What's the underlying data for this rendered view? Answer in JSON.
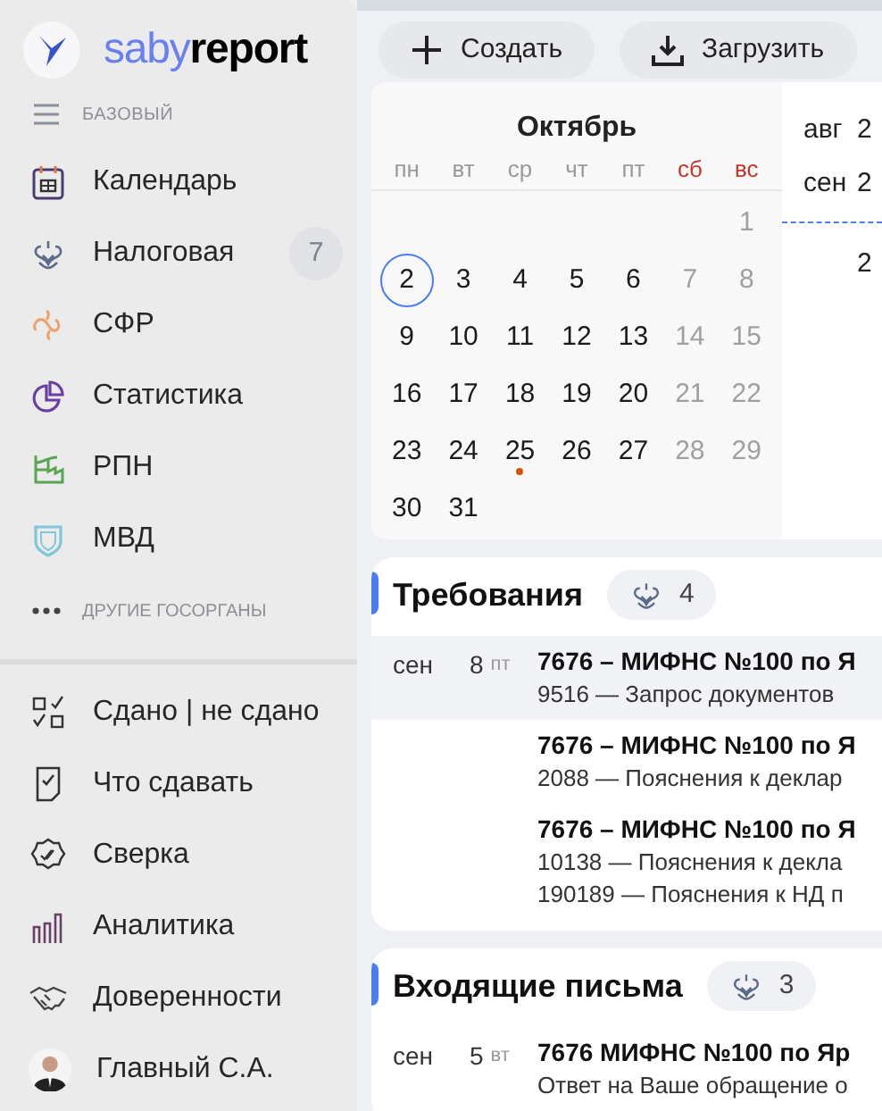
{
  "logo": {
    "part1": "saby",
    "part2": "report"
  },
  "sidebar": {
    "section": "БАЗОВЫЙ",
    "items": [
      {
        "label": "Календарь",
        "kind": "calendar"
      },
      {
        "label": "Налоговая",
        "kind": "eagle",
        "badge": "7"
      },
      {
        "label": "СФР",
        "kind": "loop"
      },
      {
        "label": "Статистика",
        "kind": "pie"
      },
      {
        "label": "РПН",
        "kind": "factory"
      },
      {
        "label": "МВД",
        "kind": "shield"
      }
    ],
    "more": "ДРУГИЕ ГОСОРГАНЫ",
    "tools": [
      {
        "label": "Сдано | не сдано",
        "kind": "checklist"
      },
      {
        "label": "Что сдавать",
        "kind": "document"
      },
      {
        "label": "Сверка",
        "kind": "seal"
      },
      {
        "label": "Аналитика",
        "kind": "bars"
      },
      {
        "label": "Доверенности",
        "kind": "handshake"
      },
      {
        "label": "Главный С.А.",
        "kind": "avatar"
      }
    ]
  },
  "toolbar": [
    {
      "label": "Создать",
      "kind": "plus"
    },
    {
      "label": "Загрузить",
      "kind": "download"
    }
  ],
  "calendar": {
    "month": "Октябрь",
    "weekdays": [
      {
        "label": "пн",
        "weekend": false
      },
      {
        "label": "вт",
        "weekend": false
      },
      {
        "label": "ср",
        "weekend": false
      },
      {
        "label": "чт",
        "weekend": false
      },
      {
        "label": "пт",
        "weekend": false
      },
      {
        "label": "сб",
        "weekend": true
      },
      {
        "label": "вс",
        "weekend": true
      }
    ],
    "weeks": [
      [
        {
          "day": "1",
          "weekend": true,
          "today": false,
          "event": false
        }
      ],
      [
        {
          "day": "2",
          "weekend": false,
          "today": true,
          "event": false
        },
        {
          "day": "3",
          "weekend": false,
          "today": false,
          "event": false
        },
        {
          "day": "4",
          "weekend": false,
          "today": false,
          "event": false
        },
        {
          "day": "5",
          "weekend": false,
          "today": false,
          "event": false
        },
        {
          "day": "6",
          "weekend": false,
          "today": false,
          "event": false
        },
        {
          "day": "7",
          "weekend": true,
          "today": false,
          "event": false
        },
        {
          "day": "8",
          "weekend": true,
          "today": false,
          "event": false
        }
      ],
      [
        {
          "day": "9",
          "weekend": false,
          "today": false,
          "event": false
        },
        {
          "day": "10",
          "weekend": false,
          "today": false,
          "event": false
        },
        {
          "day": "11",
          "weekend": false,
          "today": false,
          "event": false
        },
        {
          "day": "12",
          "weekend": false,
          "today": false,
          "event": false
        },
        {
          "day": "13",
          "weekend": false,
          "today": false,
          "event": false
        },
        {
          "day": "14",
          "weekend": true,
          "today": false,
          "event": false
        },
        {
          "day": "15",
          "weekend": true,
          "today": false,
          "event": false
        }
      ],
      [
        {
          "day": "16",
          "weekend": false,
          "today": false,
          "event": false
        },
        {
          "day": "17",
          "weekend": false,
          "today": false,
          "event": false
        },
        {
          "day": "18",
          "weekend": false,
          "today": false,
          "event": false
        },
        {
          "day": "19",
          "weekend": false,
          "today": false,
          "event": false
        },
        {
          "day": "20",
          "weekend": false,
          "today": false,
          "event": false
        },
        {
          "day": "21",
          "weekend": true,
          "today": false,
          "event": false
        },
        {
          "day": "22",
          "weekend": true,
          "today": false,
          "event": false
        }
      ],
      [
        {
          "day": "23",
          "weekend": false,
          "today": false,
          "event": false
        },
        {
          "day": "24",
          "weekend": false,
          "today": false,
          "event": false
        },
        {
          "day": "25",
          "weekend": false,
          "today": false,
          "event": true
        },
        {
          "day": "26",
          "weekend": false,
          "today": false,
          "event": false
        },
        {
          "day": "27",
          "weekend": false,
          "today": false,
          "event": false
        },
        {
          "day": "28",
          "weekend": true,
          "today": false,
          "event": false
        },
        {
          "day": "29",
          "weekend": true,
          "today": false,
          "event": false
        }
      ],
      [
        {
          "day": "30",
          "weekend": false,
          "today": false,
          "event": false
        },
        {
          "day": "31",
          "weekend": false,
          "today": false,
          "event": false
        }
      ]
    ]
  },
  "timeline": [
    {
      "month": "авг",
      "day": "2",
      "marker_before": false
    },
    {
      "month": "сен",
      "day": "2",
      "marker_before": false
    },
    {
      "day": "2",
      "marker_before": true
    }
  ],
  "sections": [
    {
      "title": "Требования",
      "count": "4",
      "rows": [
        {
          "month": "сен",
          "day": "8",
          "weekday": "пт",
          "selected": true,
          "title": "7676 – МИФНС №100 по Я",
          "lines": [
            "9516 — Запрос документов"
          ]
        },
        {
          "selected": false,
          "title": "7676 – МИФНС №100 по Я",
          "lines": [
            "2088 — Пояснения к деклар"
          ]
        },
        {
          "selected": false,
          "title": "7676 – МИФНС №100 по Я",
          "lines": [
            "10138 — Пояснения к декла",
            "190189 — Пояснения к НД п"
          ]
        }
      ]
    },
    {
      "title": "Входящие письма",
      "count": "3",
      "rows": [
        {
          "month": "сен",
          "day": "5",
          "weekday": "вт",
          "selected": false,
          "title": "7676 МИФНС №100 по Яр",
          "lines": [
            "Ответ на Ваше обращение о"
          ]
        }
      ]
    }
  ]
}
